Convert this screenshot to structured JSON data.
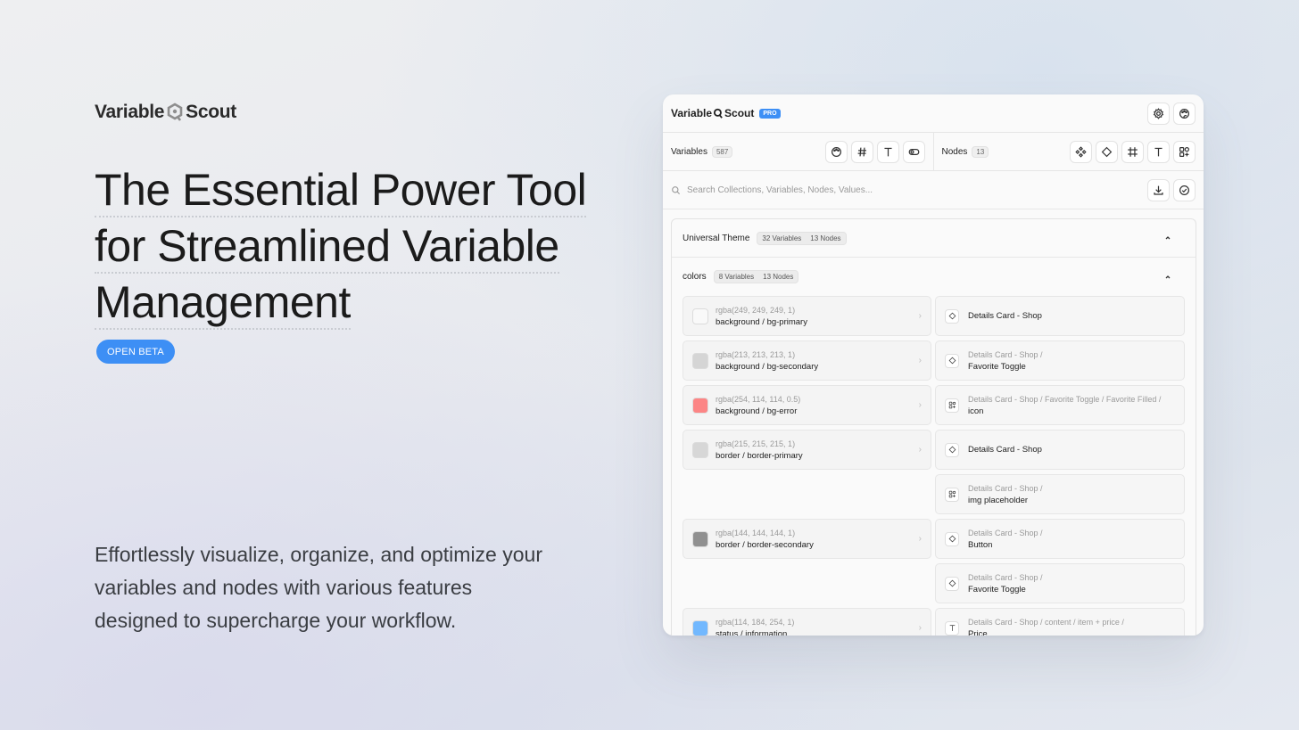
{
  "hero": {
    "brand_left": "Variable",
    "brand_right": "Scout",
    "title_lines": [
      "The Essential Power Tool",
      "for Streamlined Variable",
      "Management"
    ],
    "badge": "OPEN BETA",
    "description": "Effortlessly visualize, organize, and optimize your variables and nodes with various features designed to supercharge your workflow."
  },
  "panel": {
    "brand_left": "Variable",
    "brand_right": "Scout",
    "pro_badge": "PRO",
    "tabs": {
      "variables_label": "Variables",
      "variables_count": "587",
      "nodes_label": "Nodes",
      "nodes_count": "13"
    },
    "search": {
      "placeholder": "Search Collections, Variables, Nodes, Values..."
    },
    "collection": {
      "name": "Universal Theme",
      "variables": "32 Variables",
      "nodes": "13 Nodes"
    },
    "group": {
      "name": "colors",
      "variables": "8 Variables",
      "nodes": "13 Nodes"
    },
    "rows": [
      {
        "var": {
          "value": "rgba(249, 249, 249, 1)",
          "name": "background / bg-primary",
          "color": "#f9f9f9"
        },
        "node": {
          "path": "",
          "name": "Details Card - Shop",
          "icon": "component-icon"
        }
      },
      {
        "var": {
          "value": "rgba(213, 213, 213, 1)",
          "name": "background / bg-secondary",
          "color": "#d5d5d5"
        },
        "node": {
          "path": "Details Card - Shop /",
          "name": "Favorite Toggle",
          "icon": "component-icon"
        }
      },
      {
        "var": {
          "value": "rgba(254, 114, 114, 0.5)",
          "name": "background / bg-error",
          "color": "#fe7272"
        },
        "node": {
          "path": "Details Card - Shop / Favorite Toggle / Favorite Filled /",
          "name": "icon",
          "icon": "group-icon"
        }
      },
      {
        "var": {
          "value": "rgba(215, 215, 215, 1)",
          "name": "border / border-primary",
          "color": "#d7d7d7"
        },
        "node": {
          "path": "",
          "name": "Details Card - Shop",
          "icon": "component-icon"
        }
      },
      {
        "var": null,
        "node": {
          "path": "Details Card - Shop /",
          "name": "img placeholder",
          "icon": "group-icon"
        }
      },
      {
        "var": {
          "value": "rgba(144, 144, 144, 1)",
          "name": "border / border-secondary",
          "color": "#909090"
        },
        "node": {
          "path": "Details Card - Shop /",
          "name": "Button",
          "icon": "component-icon"
        }
      },
      {
        "var": null,
        "node": {
          "path": "Details Card - Shop /",
          "name": "Favorite Toggle",
          "icon": "component-icon"
        }
      },
      {
        "var": {
          "value": "rgba(114, 184, 254, 1)",
          "name": "status / information",
          "color": "#72b8fe"
        },
        "node": {
          "path": "Details Card - Shop / content / item + price /",
          "name": "Price",
          "icon": "text-icon"
        }
      }
    ]
  }
}
